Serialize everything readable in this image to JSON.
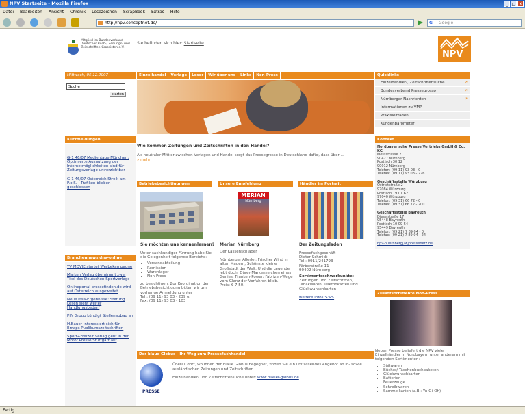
{
  "window": {
    "title": "NPV Startseite - Mozilla Firefox",
    "min": "_",
    "max": "□",
    "close": "X"
  },
  "menu": [
    "Datei",
    "Bearbeiten",
    "Ansicht",
    "Chronik",
    "Lesezeichen",
    "ScrapBook",
    "Extras",
    "Hilfe"
  ],
  "nav": {
    "url": "http://npv.conceptnet.de/",
    "search_placeholder": "Google"
  },
  "status": "Fertig",
  "header": {
    "logo_text": "Mitglied im Bundesverband Deutscher Buch-, Zeitungs- und Zeitschriften-Grossisten e.V.",
    "breadcrumb_prefix": "Sie befinden sich hier:",
    "breadcrumb_link": "Startseite",
    "brand": "NPV"
  },
  "datebar": "Mittwoch, 05.12.2007",
  "mainnav": [
    "Einzelhandel",
    "Verlage",
    "Leser",
    "Wir über uns",
    "Links",
    "Non-Press"
  ],
  "search": {
    "value": "Suche",
    "button": "starten"
  },
  "kurzmeldungen": {
    "title": "Kurzmeldungen",
    "items": [
      "G-1 46/07 Medientage München: Optimierte Ausnutzung der Internetmöglichkeiten sind für Zeitungsverlage unverzichtbar",
      "G-1 46/07 Österreich Streik am P.o.S. - Trafiken blieben geschlossen"
    ]
  },
  "branchennews": {
    "title": "Branchennews dnv-online",
    "items": [
      "TV MOVIE startet Werbekampagne",
      "Marken Verlag übernimmt zwei Titel des Deutschen Sportverlags",
      "Onlineportal pressefinden.de wird auf Österreich ausgeweitet",
      "Neue Pisa-Ergebnisse: Stiftung Lesen sieht weiter Handlungsbedarf",
      "PIN Group kündigt Stellenabbau an",
      "H.Bauer interessiert sich für Emaps Publikumszeitschriften",
      "Sport+Freizeit Verlag geht in der Motor Presse Stuttgart auf"
    ]
  },
  "quicklinks": {
    "title": "Quicklinks",
    "items": [
      "Einzelhändler-, Zeitschriftensuche",
      "Bundesverband Pressegrosso",
      "Nürnberger Nachrichten",
      "Informationen zu VMP",
      "Praxisleitfaden",
      "Kundenbarometer"
    ]
  },
  "kontakt": {
    "title": "Kontakt",
    "blocks": [
      {
        "name": "Nordbayerische Presse Vertriebs GmbH & Co. KG",
        "lines": [
          "Messstrasse 2",
          "90427 Nürnberg",
          "Postfach 30 12",
          "90012 Nürnberg",
          "Telefon: (09 11) 93 03 - 0",
          "Telefax: (09 11) 93 03 - 276"
        ]
      },
      {
        "name": "Geschäftsstelle Würzburg",
        "lines": [
          "Ostrietstraße 2",
          "97084 Würzburg",
          "Postfach 19 01 62",
          "97040 Würzburg",
          "Telefon: (09 31) 66 72 - 0",
          "Telefax: (09 31) 66 72 - 200"
        ]
      },
      {
        "name": "Geschäftsstelle Bayreuth",
        "lines": [
          "Dieselstraße 17",
          "95448 Bayreuth",
          "Postfach 10 09 54",
          "95449 Bayreuth",
          "Telefon: (09 21) 7 89 04 - 0",
          "Telefax: (09 21) 7 89 04 - 24"
        ]
      }
    ],
    "email": "npv-nuernberg[at]pressenetz.de"
  },
  "intro": {
    "title": "Wie kommen Zeitungen und Zeitschriften in den Handel?",
    "text": "Als neutraler Mittler zwischen Verlagen und Handel sorgt das Pressegrosso in Deutschland dafür, dass über ...",
    "more": "» mehr"
  },
  "col1": {
    "title": "Betriebsbesichtigungen",
    "heading": "Sie möchten uns kennenlernen?",
    "text": "Unter sachkundiger Führung habe Sie die Gelegenheit folgende Bereiche:",
    "list": [
      "Versandabteilung",
      "Remission",
      "Warenlager",
      "Non-Press"
    ],
    "text2": "zu besichtigen. Zur Koordination der Betriebsbesichtigung bitten wir um vorherige Anmeldung unter",
    "tel": "Tel.: (09 11) 93 03 - 239 o.",
    "fax": "Fax: (09 11) 93 03 - 103"
  },
  "col2": {
    "title": "Unsere Empfehlung",
    "cover_brand": "MERIAN",
    "cover_sub": "Nürnberg",
    "heading": "Merian Nürnberg",
    "sub": "Der Kassenschlager",
    "text": "Nürnberger Allerlei: Frischer Wind in alten Mauern; Schönste kleine Großstadt der Welt; Und die Legende lebt doch: Dürer-Markenzeichen eines Genies; Franken-Power: Fabrizen-Wege vom Glanz der Vorfahren blieb.",
    "price": "Preis: € 7,50."
  },
  "col3": {
    "title": "Händler im Portrait",
    "heading": "Der Zeitungsladen",
    "lines": [
      "Pressefachgeschäft",
      "Dieter Schmidt",
      "Tel.: 0911/241793",
      "Färberstraße 11",
      "90402 Nürnberg"
    ],
    "sub": "Sortimentsschwerkunkte:",
    "text": "Zeitungen und Zeitschriften, Tabakwaren, Telefonkarten und Glückwunschkarten",
    "more": "weitere Infos >>>"
  },
  "globe": {
    "title": "Der blaue Globus - Ihr Weg zum Pressefachhandel",
    "text1": "Überall dort, wo Ihnen der blaue Globus begegnet, finden Sie ein umfassendes Angebot an in- sowie ausländischen Zeitungen und Zeitschriften.",
    "text2": "Einzelhändler- und Zeitschriftensuche unter:",
    "link": "www.blauer-globus.de",
    "label": "PRESSE"
  },
  "zusatz": {
    "title": "Zusatzsortimente Non-Press",
    "text": "Neben Presse beliefert die NPV viele Einzelhändler in Nordbayern unter anderem mit folgenden Sortimenten:",
    "items": [
      "Süßwaren",
      "Bücher/ Taschenbuchpaketen",
      "Glückwunschkarten",
      "Batterien",
      "Feuerzeuge",
      "Schreibwaren",
      "Sammelkarten (z.B.: Yu-Gi-Oh)"
    ]
  }
}
